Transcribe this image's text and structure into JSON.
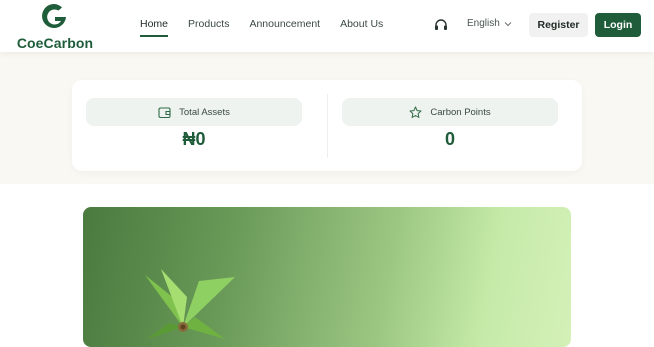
{
  "brand": {
    "name": "CoeCarbon"
  },
  "nav": {
    "links": [
      {
        "label": "Home",
        "active": true
      },
      {
        "label": "Products",
        "active": false
      },
      {
        "label": "Announcement",
        "active": false
      },
      {
        "label": "About Us",
        "active": false
      }
    ],
    "language": "English",
    "register_label": "Register",
    "login_label": "Login"
  },
  "stats": {
    "total_assets": {
      "label": "Total Assets",
      "value": "₦0"
    },
    "carbon_points": {
      "label": "Carbon Points",
      "value": "0"
    }
  },
  "icons": {
    "logo": "leaf-g-logo-icon",
    "support": "headset-icon",
    "language_chevron": "chevron-down-icon",
    "assets": "wallet-icon",
    "points": "star-icon"
  },
  "colors": {
    "primary": "#1f5c3a",
    "accent_bg": "#eef3ef",
    "band_bg": "#faf8f2"
  }
}
